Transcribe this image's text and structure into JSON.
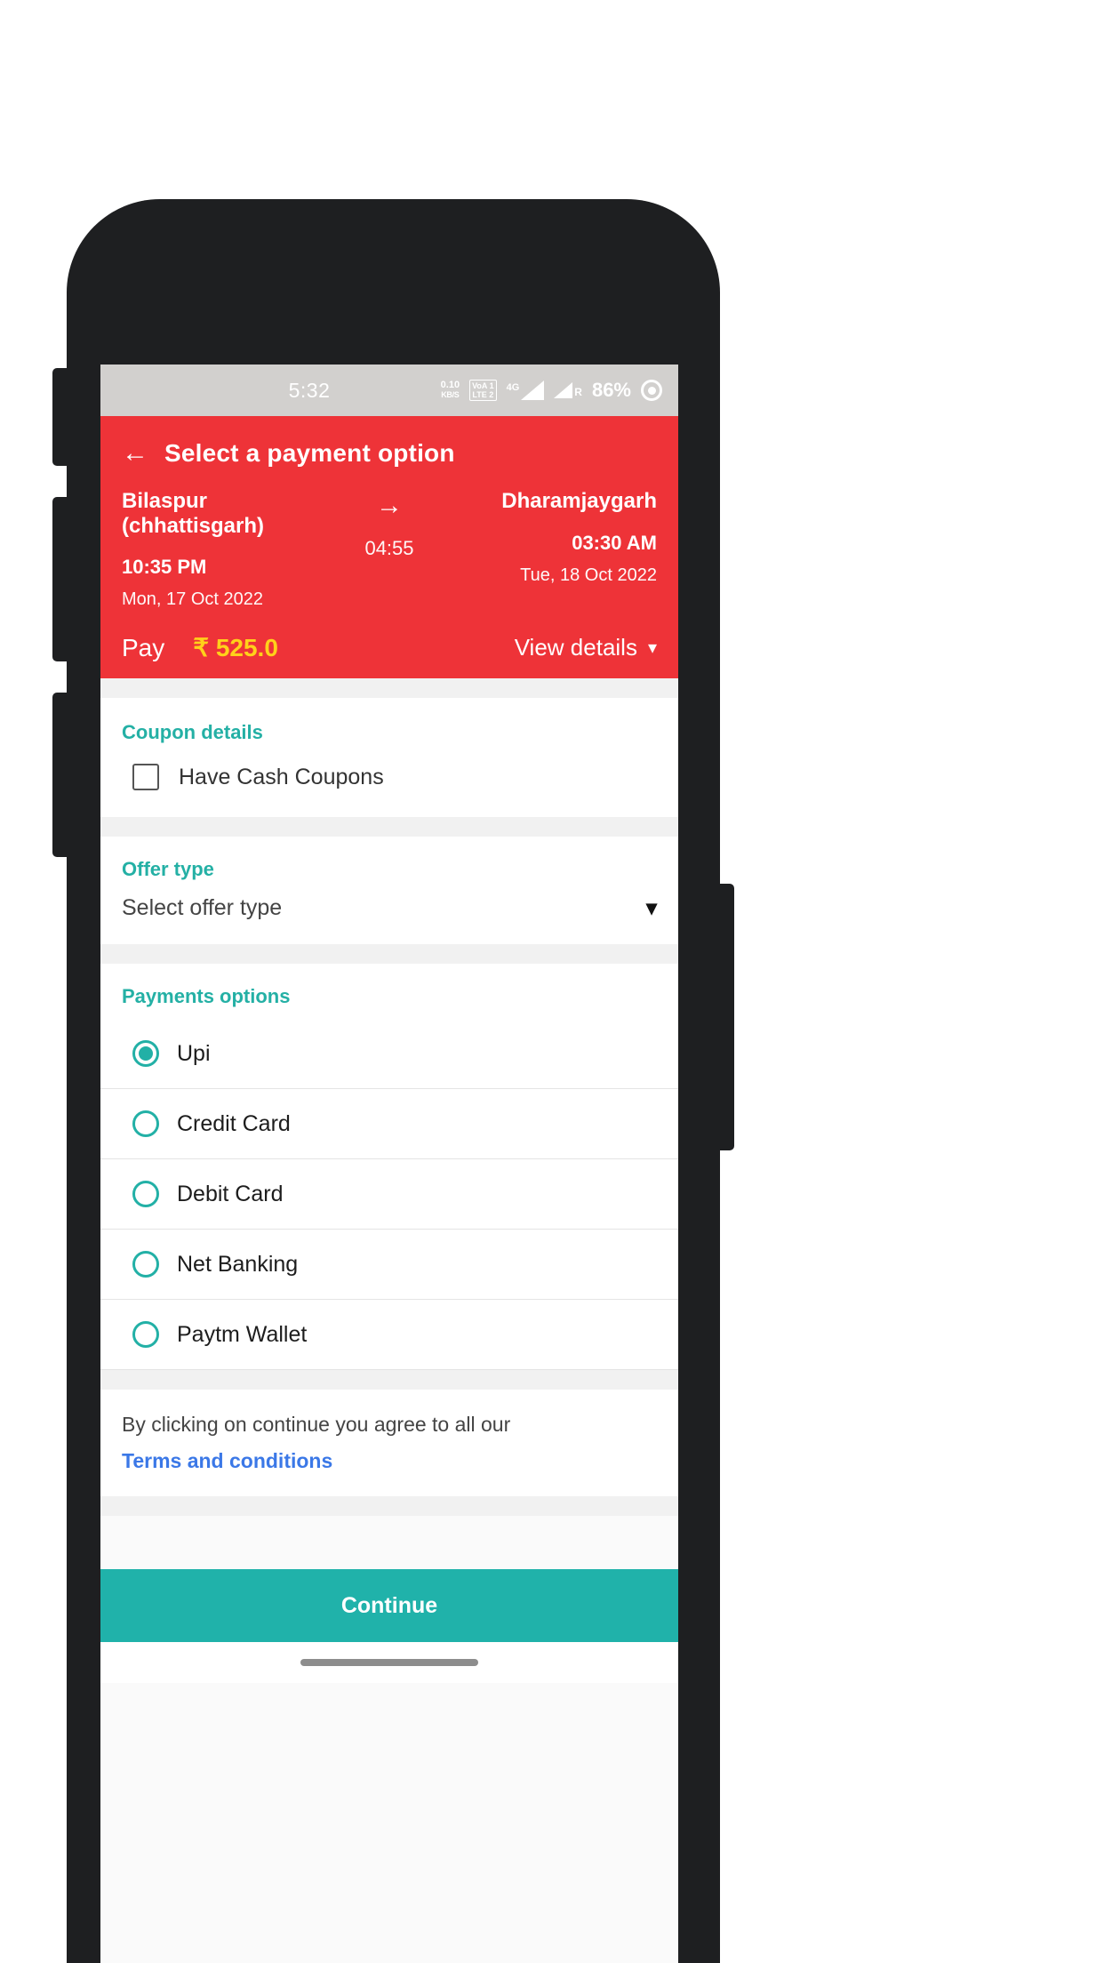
{
  "status_bar": {
    "time": "5:32",
    "data_speed": "0.10",
    "data_unit": "KB/S",
    "volte_line1": "VoA 1",
    "volte_line2": "LTE 2",
    "network": "4G",
    "roaming": "R",
    "battery_percent": "86%",
    "battery_icon": "battery-circle-icon"
  },
  "header": {
    "back_icon": "back-arrow-icon",
    "title": "Select a payment option",
    "journey": {
      "origin_city": "Bilaspur (chhattisgarh)",
      "origin_time": "10:35 PM",
      "origin_date": "Mon, 17 Oct 2022",
      "duration": "04:55",
      "arrow_icon": "arrow-right-icon",
      "destination_city": "Dharamjaygarh",
      "destination_time": "03:30 AM",
      "destination_date": "Tue, 18 Oct 2022"
    },
    "pay_label": "Pay",
    "pay_amount": "₹ 525.0",
    "view_details_label": "View details",
    "view_details_icon": "chevron-down-icon"
  },
  "coupon": {
    "section_title": "Coupon details",
    "checkbox_label": "Have Cash Coupons",
    "checked": false
  },
  "offer": {
    "section_title": "Offer type",
    "selected_value": "Select offer type",
    "dropdown_icon": "chevron-down-icon"
  },
  "payments": {
    "section_title": "Payments options",
    "options": [
      {
        "label": "Upi",
        "selected": true
      },
      {
        "label": "Credit Card",
        "selected": false
      },
      {
        "label": "Debit Card",
        "selected": false
      },
      {
        "label": "Net Banking",
        "selected": false
      },
      {
        "label": "Paytm Wallet",
        "selected": false
      }
    ]
  },
  "terms": {
    "text": "By clicking on continue you agree to all our",
    "link": "Terms and conditions"
  },
  "footer": {
    "continue_label": "Continue"
  },
  "colors": {
    "brand_red": "#ee3338",
    "accent_teal": "#20b2aa",
    "section_teal": "#24b0a5",
    "amount_yellow": "#ffd11a",
    "link_blue": "#3b78e7"
  }
}
